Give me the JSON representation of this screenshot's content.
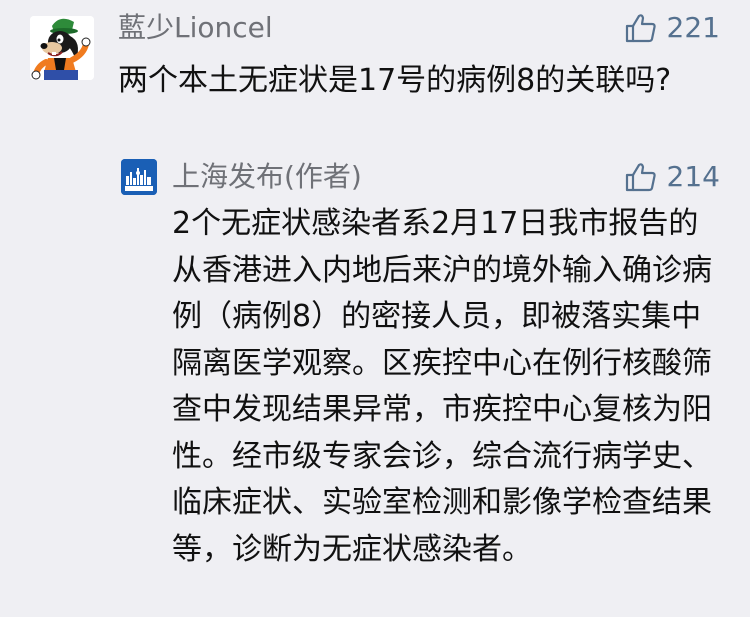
{
  "comment": {
    "avatar_icon": "goofy-avatar-icon",
    "username": "藍少Lioncel",
    "likes": "221",
    "text": "两个本土无症状是17号的病例8的关联吗?"
  },
  "reply": {
    "avatar_icon": "shanghai-fabu-logo-icon",
    "author": "上海发布(作者)",
    "likes": "214",
    "text": "2个无症状感染者系2月17日我市报告的从香港进入内地后来沪的境外输入确诊病例（病例8）的密接人员，即被落实集中隔离医学观察。区疾控中心在例行核酸筛查中发现结果异常，市疾控中心复核为阳性。经市级专家会诊，综合流行病学史、临床症状、实验室检测和影像学检查结果等，诊断为无症状感染者。"
  },
  "colors": {
    "background": "#efeff3",
    "meta_gray": "#6f7177",
    "like_blue": "#55718f",
    "body_text": "#111111",
    "logo_blue": "#1a5fb5"
  }
}
